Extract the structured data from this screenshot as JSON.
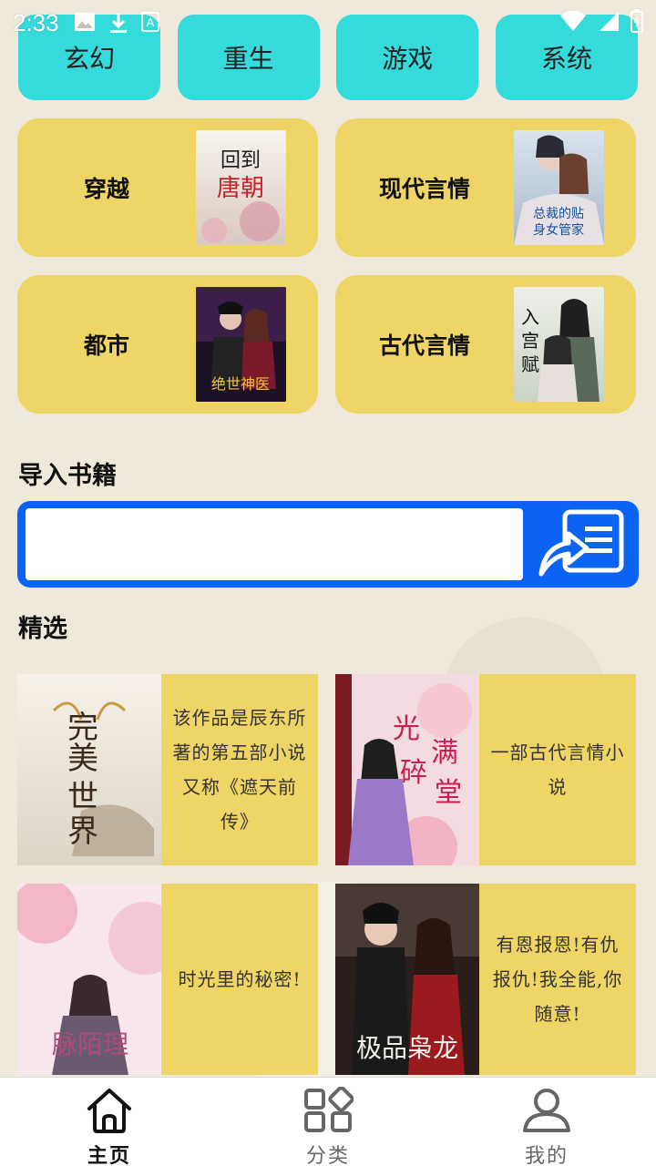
{
  "status": {
    "time": "2:33",
    "icons": [
      "image-icon",
      "download-icon",
      "text-icon",
      "wifi-icon",
      "signal-icon",
      "battery-icon"
    ]
  },
  "tags": [
    {
      "label": "玄幻"
    },
    {
      "label": "重生"
    },
    {
      "label": "游戏"
    },
    {
      "label": "系统"
    }
  ],
  "genres": [
    {
      "label": "穿越",
      "cover_text": "回到唐朝"
    },
    {
      "label": "现代言情",
      "cover_text": "总裁的贴身女管家"
    },
    {
      "label": "都市",
      "cover_text": "绝世神医"
    },
    {
      "label": "古代言情",
      "cover_text": "入宫赋"
    }
  ],
  "import_section": {
    "title": "导入书籍",
    "input_value": "",
    "input_placeholder": ""
  },
  "featured_section": {
    "title": "精选"
  },
  "featured": [
    {
      "cover_text": "完美世界",
      "description": "该作品是辰东所著的第五部小说又称《遮天前传》"
    },
    {
      "cover_text": "光碎满堂",
      "description": "一部古代言情小说"
    },
    {
      "cover_text": "脉陌理",
      "description": "时光里的秘密!"
    },
    {
      "cover_text": "极品枭龙",
      "description": "有恩报恩!有仇报仇!我全能,你随意!"
    }
  ],
  "nav": [
    {
      "label": "主页",
      "icon": "home-icon",
      "active": true
    },
    {
      "label": "分类",
      "icon": "category-icon",
      "active": false
    },
    {
      "label": "我的",
      "icon": "profile-icon",
      "active": false
    }
  ],
  "colors": {
    "tag_bg": "#35dada",
    "card_bg": "#efd565",
    "import_blue": "#0a63f2",
    "page_bg": "#efe9dc"
  }
}
